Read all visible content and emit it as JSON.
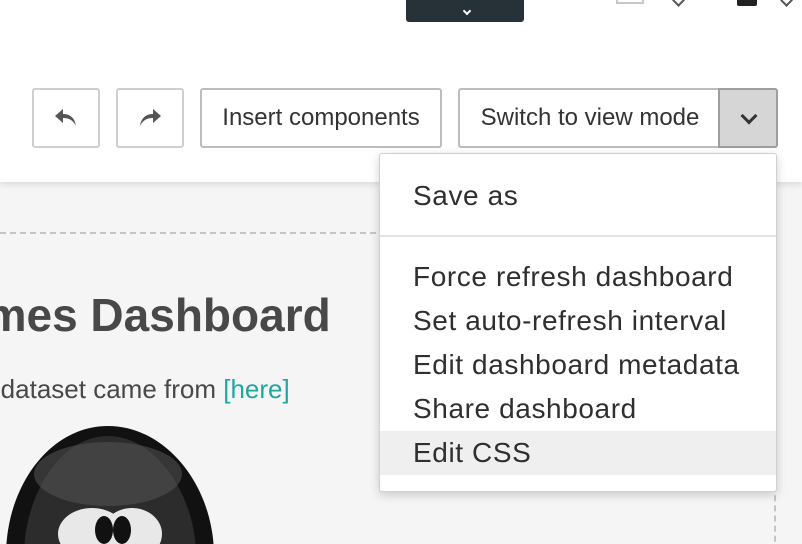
{
  "toolbar": {
    "undo_icon": "undo-arrow",
    "redo_icon": "redo-arrow",
    "insert_label": "Insert components",
    "mode_label": "Switch to view mode",
    "dropdown_icon": "chevron-down"
  },
  "menu": {
    "items": [
      "Save as",
      "Force refresh dashboard",
      "Set auto-refresh interval",
      "Edit dashboard metadata",
      "Share dashboard",
      "Edit CSS"
    ],
    "active_index": 5
  },
  "dashboard": {
    "title": "ames Dashboard",
    "subtitle_text": "ce dataset came from ",
    "subtitle_link": "[here]"
  },
  "colors": {
    "accent": "#20a7a0",
    "navbar_button": "#263238",
    "menu_hover": "#efefef"
  }
}
